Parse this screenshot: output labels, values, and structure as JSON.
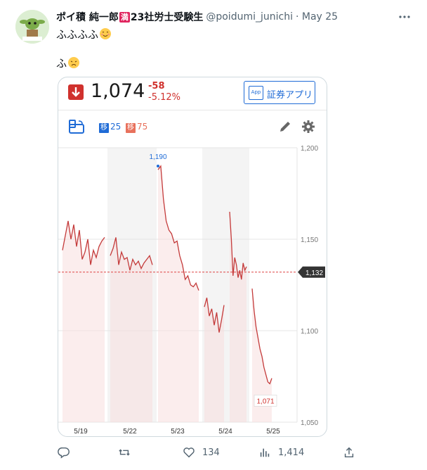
{
  "tweet": {
    "display_name": "ポイ積 純一郎",
    "badge": "満",
    "name_suffix": "23社労士受験生",
    "handle": "@poidumi_junichi",
    "date": "· May 25",
    "line1": "ふふふふ",
    "line2": "ふ",
    "more_icon": "more-icon",
    "accent_color": "#1d9bf0"
  },
  "quote": {
    "price": "1,074",
    "change": "-58",
    "change_pct": "-5.12%",
    "app_label": "証券アプリ",
    "app_icon_text": "App",
    "down_color": "#d0312d",
    "up_color": "#1f6bd6"
  },
  "toolbar": {
    "ma_tag_1": "移",
    "ma_value_1": "25",
    "ma_tag_2": "移",
    "ma_value_2": "75",
    "ma_color_1": "#1f6bd6",
    "ma_color_2": "#e8715c"
  },
  "chart_data": {
    "type": "line",
    "ylim": [
      1050,
      1200
    ],
    "y_ticks": [
      "1,200",
      "1,150",
      "1,100",
      "1,050"
    ],
    "x_labels": [
      "5/19",
      "5/22",
      "5/23",
      "5/24",
      "5/25"
    ],
    "reference_line": {
      "value": 1132,
      "label": "1,132"
    },
    "annotations": [
      {
        "label": "1,190",
        "value": 1190,
        "kind": "high"
      },
      {
        "label": "1,071",
        "value": 1071,
        "kind": "low"
      }
    ],
    "series": [
      {
        "day": "5/19",
        "values": [
          1144,
          1152,
          1160,
          1150,
          1158,
          1146,
          1155,
          1139,
          1143,
          1150,
          1136,
          1144,
          1140,
          1146,
          1149,
          1151
        ]
      },
      {
        "day": "5/22",
        "values": [
          1141,
          1145,
          1151,
          1136,
          1143,
          1139,
          1140,
          1133,
          1139,
          1136,
          1138,
          1134,
          1137,
          1139,
          1141,
          1136
        ]
      },
      {
        "day": "5/23",
        "values": [
          1188,
          1190,
          1172,
          1160,
          1155,
          1153,
          1148,
          1149,
          1141,
          1136,
          1128,
          1130,
          1125,
          1124,
          1126,
          1122
        ]
      },
      {
        "day": "5/23 PM",
        "values": [
          1113,
          1118,
          1108,
          1112,
          1103,
          1110,
          1099,
          1106,
          1114
        ]
      },
      {
        "day": "5/24",
        "values": [
          1165,
          1150,
          1130,
          1140,
          1136,
          1129,
          1133,
          1128,
          1137,
          1133,
          1135
        ]
      },
      {
        "day": "5/25",
        "values": [
          1123,
          1111,
          1102,
          1096,
          1090,
          1086,
          1080,
          1076,
          1072,
          1071,
          1074
        ]
      }
    ],
    "line_color": "#c43a3a"
  },
  "actions": {
    "reply": "",
    "retweet": "",
    "likes": "134",
    "views": "1,414"
  }
}
